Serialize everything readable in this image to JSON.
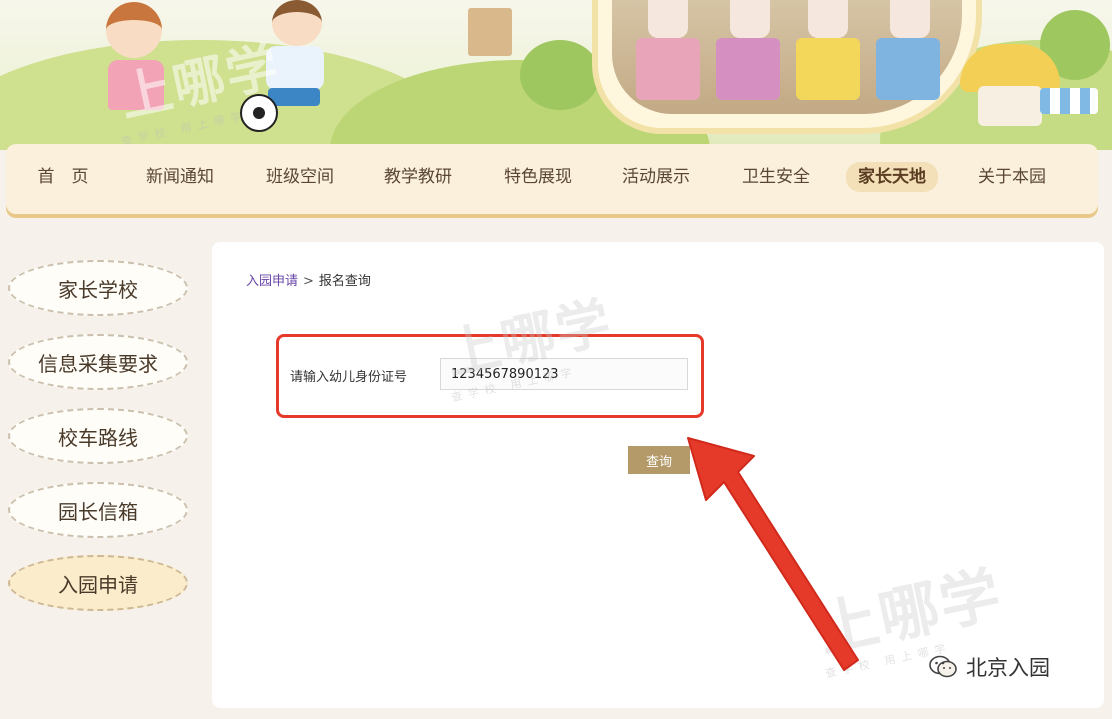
{
  "watermark": {
    "brand": "上哪学",
    "tagline": "查学校 用上哪学"
  },
  "nav": {
    "items": [
      {
        "label": "首　页",
        "active": false
      },
      {
        "label": "新闻通知",
        "active": false
      },
      {
        "label": "班级空间",
        "active": false
      },
      {
        "label": "教学教研",
        "active": false
      },
      {
        "label": "特色展现",
        "active": false
      },
      {
        "label": "活动展示",
        "active": false
      },
      {
        "label": "卫生安全",
        "active": false
      },
      {
        "label": "家长天地",
        "active": true
      },
      {
        "label": "关于本园",
        "active": false
      }
    ]
  },
  "sidebar": {
    "items": [
      {
        "label": "家长学校",
        "active": false
      },
      {
        "label": "信息采集要求",
        "active": false
      },
      {
        "label": "校车路线",
        "active": false
      },
      {
        "label": "园长信箱",
        "active": false
      },
      {
        "label": "入园申请",
        "active": true
      }
    ]
  },
  "breadcrumb": {
    "parent": "入园申请",
    "separator": ">",
    "current": "报名查询"
  },
  "form": {
    "id_label": "请输入幼儿身份证号",
    "id_value": "1234567890123",
    "query_label": "查询"
  },
  "footer": {
    "account_name": "北京入园"
  },
  "colors": {
    "highlight": "#e53a2a",
    "button": "#b39a68",
    "breadcrumb_link": "#6b46a8",
    "nav_background": "#fbf0dc"
  }
}
